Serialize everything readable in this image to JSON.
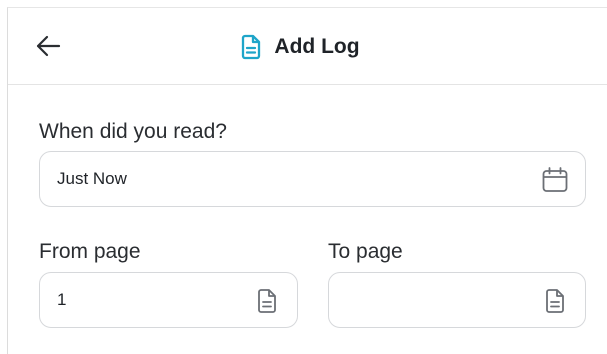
{
  "header": {
    "title": "Add Log",
    "back_icon": "arrow-left-icon",
    "title_icon": "document-icon",
    "accent_color": "#1ea5c9"
  },
  "form": {
    "when": {
      "label": "When did you read?",
      "value": "Just Now",
      "icon": "calendar-icon"
    },
    "from_page": {
      "label": "From page",
      "value": "1",
      "icon": "document-icon"
    },
    "to_page": {
      "label": "To page",
      "value": "",
      "icon": "document-icon"
    }
  }
}
